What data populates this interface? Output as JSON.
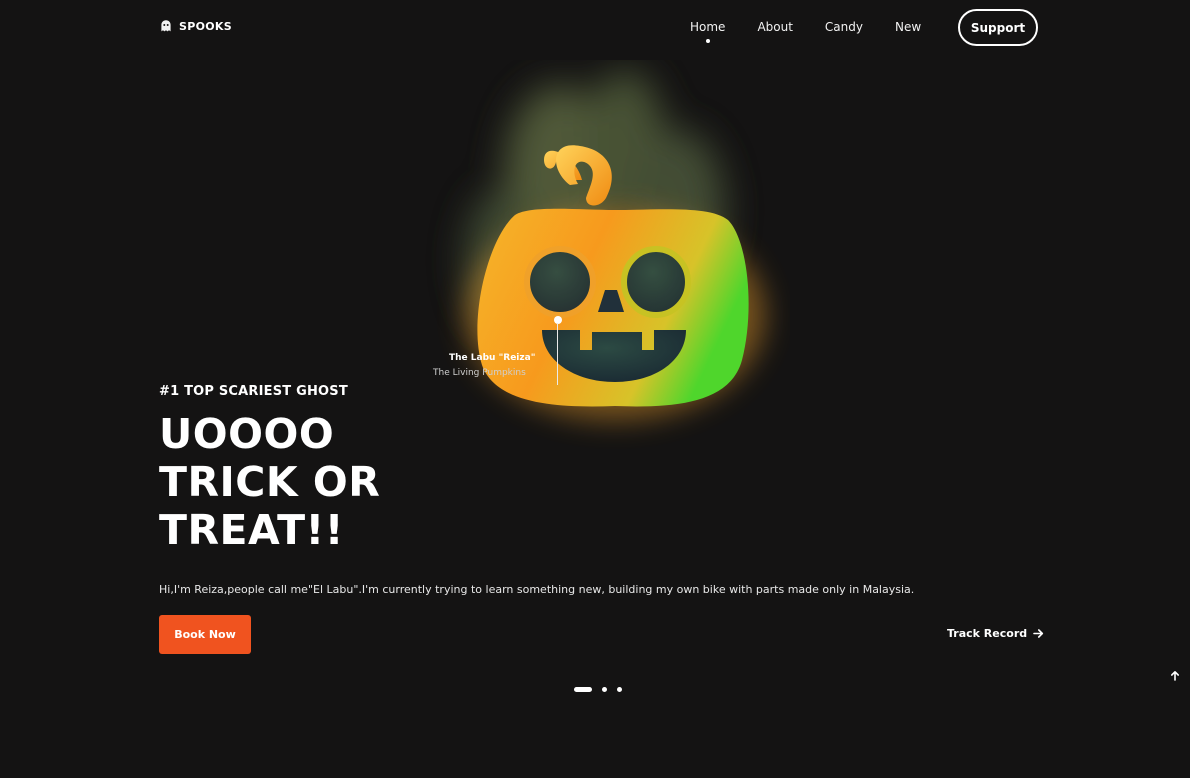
{
  "brand": {
    "name": "SPOOKS"
  },
  "nav": {
    "items": [
      {
        "label": "Home",
        "active": true
      },
      {
        "label": "About"
      },
      {
        "label": "Candy"
      },
      {
        "label": "New"
      }
    ],
    "support_label": "Support"
  },
  "callout": {
    "name": "The Labu \"Reiza\"",
    "subtitle": "The Living Pumpkins"
  },
  "hero": {
    "eyebrow": "#1 TOP SCARIEST GHOST",
    "headline": [
      "UOOOO",
      "TRICK OR",
      "TREAT!!"
    ],
    "intro": "Hi,I'm Reiza,people call me\"El Labu\".I'm currently trying to learn something new, building my own bike with parts made only in Malaysia.",
    "cta_label": "Book Now",
    "secondary_label": "Track Record"
  },
  "carousel": {
    "count": 3,
    "active_index": 0
  },
  "colors": {
    "background": "#141313",
    "accent": "#f0531f",
    "pumpkin_orange": "#f79a1d",
    "pumpkin_green": "#4fd62c"
  },
  "icons": {
    "logo": "ghost-icon",
    "secondary": "arrow-right-icon",
    "scroll": "arrow-up-icon"
  }
}
